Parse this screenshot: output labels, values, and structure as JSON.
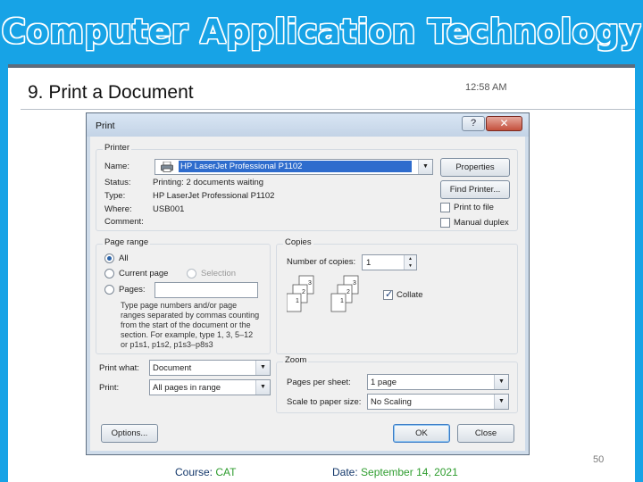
{
  "slide": {
    "title": "Computer Application Technology",
    "subtitle": "9.   Print a Document",
    "time": "12:58 AM",
    "page_number": "50",
    "footer": {
      "course_label": "Course:",
      "course_value": "CAT",
      "date_label": "Date:",
      "date_value": "September 14, 2021"
    }
  },
  "dialog": {
    "title": "Print",
    "help_label": "?",
    "close_label": "✕",
    "printer": {
      "legend": "Printer",
      "name_label": "Name:",
      "name_value": "HP LaserJet Professional P1102",
      "status_label": "Status:",
      "status_value": "Printing: 2 documents waiting",
      "type_label": "Type:",
      "type_value": "HP LaserJet Professional P1102",
      "where_label": "Where:",
      "where_value": "USB001",
      "comment_label": "Comment:",
      "properties_button": "Properties",
      "find_printer_button": "Find Printer...",
      "print_to_file_label": "Print to file",
      "print_to_file_checked": false,
      "manual_duplex_label": "Manual duplex",
      "manual_duplex_checked": false
    },
    "page_range": {
      "legend": "Page range",
      "all_label": "All",
      "current_page_label": "Current page",
      "selection_label": "Selection",
      "pages_label": "Pages:",
      "selected_option": "All",
      "hint_lines": [
        "Type page numbers and/or page",
        "ranges separated by commas counting",
        "from the start of the document or the",
        "section. For example, type 1, 3, 5–12",
        "or p1s1, p1s2, p1s3–p8s3"
      ]
    },
    "copies": {
      "legend": "Copies",
      "number_label": "Number of copies:",
      "number_value": "1",
      "collate_label": "Collate",
      "collate_checked": true
    },
    "print_what": {
      "label": "Print what:",
      "value": "Document"
    },
    "print": {
      "label": "Print:",
      "value": "All pages in range"
    },
    "zoom": {
      "legend": "Zoom",
      "pages_per_sheet_label": "Pages per sheet:",
      "pages_per_sheet_value": "1 page",
      "scale_label": "Scale to paper size:",
      "scale_value": "No Scaling"
    },
    "options_button": "Options...",
    "ok_button": "OK",
    "close_button": "Close"
  }
}
